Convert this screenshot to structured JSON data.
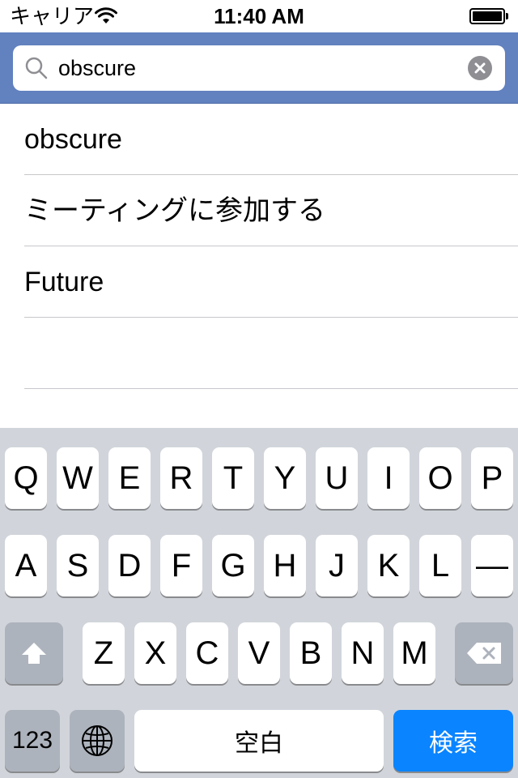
{
  "status_bar": {
    "carrier": "キャリア",
    "time": "11:40 AM",
    "battery_level": 1.0
  },
  "search": {
    "query": "obscure",
    "icon": "search-icon",
    "clear_icon": "clear-icon"
  },
  "suggestions": [
    {
      "label": "obscure"
    },
    {
      "label": "ミーティングに参加する"
    },
    {
      "label": "Future"
    },
    {
      "label": ""
    }
  ],
  "keyboard": {
    "row1": [
      "Q",
      "W",
      "E",
      "R",
      "T",
      "Y",
      "U",
      "I",
      "O",
      "P"
    ],
    "row2": [
      "A",
      "S",
      "D",
      "F",
      "G",
      "H",
      "J",
      "K",
      "L",
      "—"
    ],
    "row3": [
      "Z",
      "X",
      "C",
      "V",
      "B",
      "N",
      "M"
    ],
    "shift_icon": "shift-icon",
    "delete_icon": "delete-icon",
    "numbers_label": "123",
    "globe_icon": "globe-icon",
    "space_label": "空白",
    "search_label": "検索"
  },
  "colors": {
    "search_bar": "#6181bf",
    "keyboard_bg": "#d1d5db",
    "search_key": "#0a84ff"
  }
}
